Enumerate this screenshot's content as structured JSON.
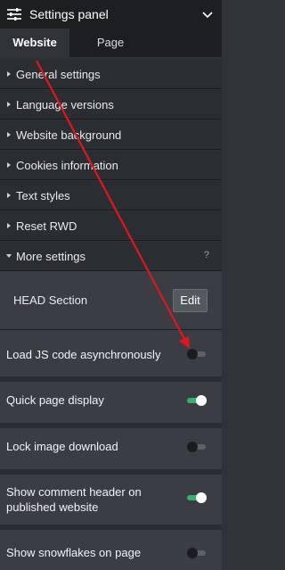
{
  "header": {
    "title": "Settings panel",
    "icon": "sliders-icon",
    "collapse_icon": "chevron-down-icon"
  },
  "tabs": [
    {
      "label": "Website",
      "active": true
    },
    {
      "label": "Page",
      "active": false
    }
  ],
  "menu": [
    {
      "label": "General settings",
      "expanded": false
    },
    {
      "label": "Language versions",
      "expanded": false
    },
    {
      "label": "Website background",
      "expanded": false
    },
    {
      "label": "Cookies information",
      "expanded": false
    },
    {
      "label": "Text styles",
      "expanded": false
    },
    {
      "label": "Reset RWD",
      "expanded": false
    },
    {
      "label": "More settings",
      "expanded": true,
      "help": "?"
    }
  ],
  "head_section": {
    "label": "HEAD Section",
    "button": "Edit"
  },
  "settings": [
    {
      "label": "Load JS code asynchronously",
      "enabled": false
    },
    {
      "label": "Quick page display",
      "enabled": true
    },
    {
      "label": "Lock image download",
      "enabled": false
    },
    {
      "label": "Show comment header on published website",
      "enabled": true
    },
    {
      "label": "Show snowflakes on page",
      "enabled": false
    }
  ],
  "colors": {
    "panel_bg": "#2f3338",
    "header_bg": "#1c1e21",
    "toggle_on": "#2fb36d",
    "annotation_arrow": "#e0161c"
  }
}
